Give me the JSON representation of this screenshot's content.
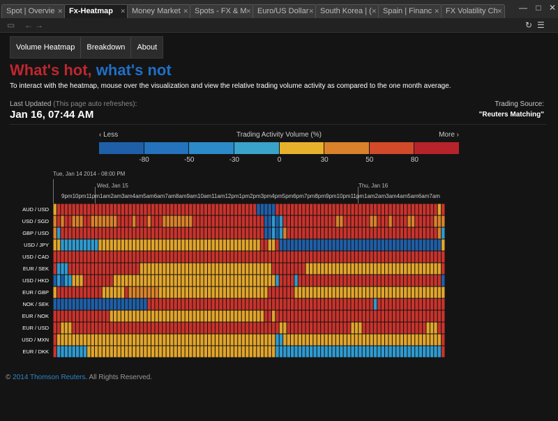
{
  "tabs": [
    {
      "label": "Spot | Overvie",
      "active": false
    },
    {
      "label": "Fx-Heatmap",
      "active": true
    },
    {
      "label": "Money Market",
      "active": false
    },
    {
      "label": "Spots - FX & M",
      "active": false
    },
    {
      "label": "Euro/US Dollar",
      "active": false
    },
    {
      "label": "South Korea | (",
      "active": false
    },
    {
      "label": "Spain | Financ",
      "active": false
    },
    {
      "label": "FX Volatility Ch",
      "active": false
    }
  ],
  "menu": [
    "Volume Heatmap",
    "Breakdown",
    "About"
  ],
  "header": {
    "hot": "What's hot,",
    "not": "what's not"
  },
  "intro": "To interact with the heatmap, mouse over the visualization and view the relative trading volume activity as compared to the one month average.",
  "last_updated": {
    "label": "Last Updated",
    "note": "(This page auto refreshes)",
    "colon": ":",
    "time": "Jan 16, 07:44 AM"
  },
  "trading_source": {
    "label": "Trading Source:",
    "value": "\"Reuters Matching\""
  },
  "legend": {
    "less": "‹ Less",
    "title": "Trading Activity Volume (%)",
    "more": "More ›",
    "colors": [
      "#1f5fa8",
      "#2473bc",
      "#2c8ac8",
      "#3aa3c9",
      "#e8b12c",
      "#d9822b",
      "#d24a2a",
      "#b7232b"
    ],
    "ticks": [
      "-80",
      "-50",
      "-30",
      "0",
      "30",
      "50",
      "80"
    ]
  },
  "heatmap": {
    "range_label": "Tue, Jan 14 2014 - 08:00 PM",
    "day_labels": [
      "Wed, Jan 15",
      "Thu, Jan 16"
    ],
    "hour_labels": "9pm10pm11pm1am2am3am4am5am6am7am8am9am10am11am12pm1pm2pm3pm4pm5pm6pm7pm8pm9pm10pm11pm1am2am3am4am5am6am7am",
    "rows": [
      {
        "pair": "AUD / USD",
        "pattern": "yrrrrrrrrrrrrrrrrrrrrrrrrrrrrrrrrrrrrrrrrrrrrrrrrrrrrrbbbbbrrrrrrrrrrrrrrrrrrrrrrrrrrrrrrrrrrrrrrrrrrr"
      },
      {
        "pair": "USD / SGD",
        "pattern": "ororrooorrooooooorrrrorrrorrroooooooorrrrrrrrrrrrrrrrrrrbbcbcrrrrrrrrrrrrrroorrrrrrroorrrorrrroorrrrroo"
      },
      {
        "pair": "GBP / USD",
        "pattern": "ocrrrrrrrrrrrrrrrrrrrrrrrrrrrrrrrrrrrrrrrrrrrrrrrrrrrrrrbbcbcorrrrrrrrrrrrrrrrrrrrrrrrrrrrrrrrrrrrrrrr"
      },
      {
        "pair": "USD / JPY",
        "pattern": "yyccccccccccyyyyyyyyyyyyyyyyyyyyyyyyyyyyyyyyyyyyyyyyyyyrryyrbbbbbbbbbbbbbbbbbbbbbbbbbbbbbbbbbbbbbbbbbbb"
      },
      {
        "pair": "USD / CAD",
        "pattern": "rrrrrrrrrrrrrrrrrrrrrrrrrrrrrrrrrrrrrrrrrrrrrrrrrrrrrrrrrrrrrrrrrrrrrrrrrrrrrrrrrrrrrrrrrrrrrrrrrrrrrr"
      },
      {
        "pair": "EUR / SEK",
        "pattern": "rcccrrrrrrrrrrrrrrrrrrryyyyyyyyyyyyyyyyyyyyyyyyyyyyyyyyyyyrrrrrrrrryyyyyyyyyyyyyyyyyyyyyyyyyyyyyyyyyyyy"
      },
      {
        "pair": "USD / HKD",
        "pattern": "bcbccyyyrrrrrrrryyyyyyyyyyyyyyyyyyyyyyyyyyyyyyyyyyyyyyyyyyycrrrrcrrrrrrrrrrrrrrrrrrrrrrrrrrrrrrrrrrrrrr"
      },
      {
        "pair": "EUR / GBP",
        "pattern": "yrrrrrrrrrrrryyyyyyrooooooooyyyyyyyyyyyyyyyyyyyyyyyyyyyyyrrrrrrryyyyyyyyyyyyyyyyyyyyyyyyyyyyyyyyyyyyyyy"
      },
      {
        "pair": "NOK / SEK",
        "pattern": "bbbbbbbbbbbbbbbbbbbbbbbbbrrrrrrrrrrrrrrrrrrrrrrrrrrrrrrrrrrrrrrrrrrrrrrrrrrrrrrrrrrrrcrrrrrrrrrrrrrrrrrr"
      },
      {
        "pair": "EUR / NOK",
        "pattern": "rrrrrrrrrrrrrrryyyyyyyyyyyyyyyyyyyyyyyyyyyyyyyyyyyyyyyyyrryrrrrrrrrrrrrrrrrrrrrrrrrrrrrrrrrrrrrrrrrrrrr"
      },
      {
        "pair": "EUR / USD",
        "pattern": "rryyyrrrrrrrrrrrrrrrrrrrrrrrrrrrrrrrrrrrrrrrrrrrrrrrrrrrrrrryyrrrrrrrrrrrrrrrrryyyrrrrrrrrrrrrrrrrryyy"
      },
      {
        "pair": "USD / MXN",
        "pattern": "ryyyyyyyyyyyyyyyyyyyyyyyyyyyyyyyyyyyyyyyyyyyyyyyyyyyyyyyyyyccyyyyyyyyyyyyyyyyyyyyyyyyyyyyyyyyyyyyyyyyyy"
      },
      {
        "pair": "EUR / DKK",
        "pattern": "rccccccccyyyyyyyyyyyyyyyyyyyyyyyyyyyyyyyyyyyyyyyyyyyyyyyyyycccccccccccccccccccccccccccccccccccccccccccc"
      }
    ]
  },
  "footer": {
    "copy": "©",
    "link": "2014 Thomson Reuters",
    "rest": ". All Rights Reserved."
  }
}
